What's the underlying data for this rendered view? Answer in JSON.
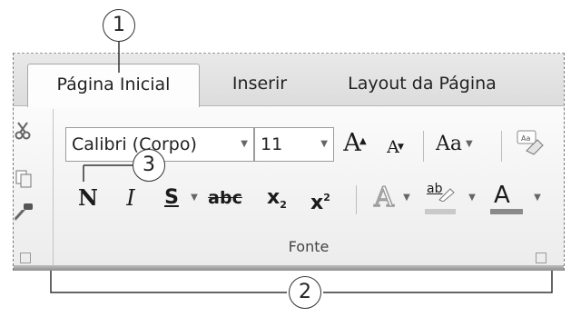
{
  "callouts": [
    "1",
    "2",
    "3"
  ],
  "tabs": [
    {
      "label": "Página Inicial",
      "active": true
    },
    {
      "label": "Inserir",
      "active": false
    },
    {
      "label": "Layout da Página",
      "active": false
    }
  ],
  "font_group": {
    "font_name": "Calibri (Corpo)",
    "font_size": "11",
    "grow_font_label": "A",
    "shrink_font_label": "A",
    "change_case_label": "Aa",
    "bold_label": "N",
    "italic_label": "I",
    "underline_label": "S",
    "strikethrough_label": "abc",
    "subscript_label": "x",
    "subscript_suffix": "2",
    "superscript_label": "x",
    "superscript_suffix": "2",
    "text_effects_label": "A",
    "highlight_label": "ab",
    "font_color_label": "A",
    "group_label": "Fonte"
  },
  "colors": {
    "highlight": "#c9c9c9",
    "font_color": "#8a8a8a"
  },
  "icons": {
    "clipboard": [
      "scissors-icon",
      "copy-icon",
      "format-painter-icon"
    ],
    "clear_formatting": "clear-formatting-icon",
    "dialog_launcher": "dialog-launcher-icon"
  }
}
